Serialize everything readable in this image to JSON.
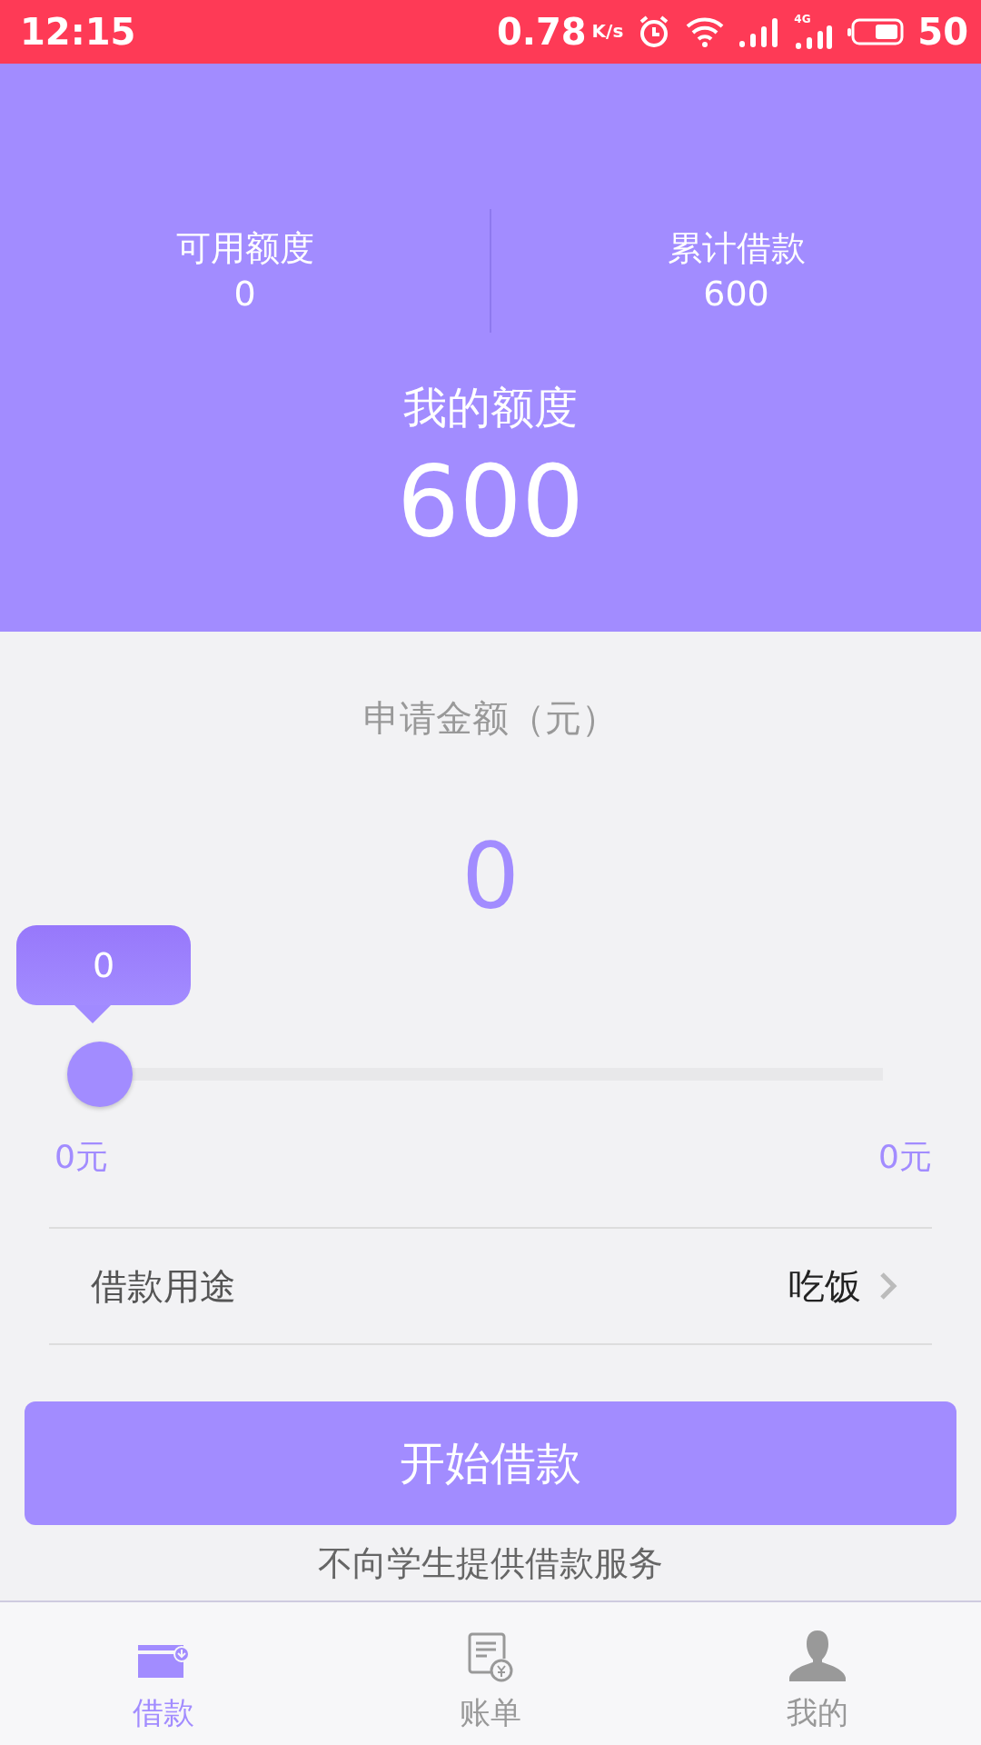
{
  "status_bar": {
    "time": "12:15",
    "speed": "0.78",
    "speed_unit": "K/s",
    "network": "4G",
    "battery": "50"
  },
  "summary": {
    "stats": [
      {
        "label": "可用额度",
        "value": "0"
      },
      {
        "label": "累计借款",
        "value": "600"
      }
    ],
    "quota_label": "我的额度",
    "quota_value": "600"
  },
  "amount": {
    "label": "申请金额（元）",
    "value": "0",
    "slider": {
      "bubble": "0",
      "level": 0,
      "min_label": "0元",
      "max_label": "0元"
    }
  },
  "purpose": {
    "label": "借款用途",
    "value": "吃饭"
  },
  "submit_button": "开始借款",
  "notice": "不向学生提供借款服务",
  "tabs": [
    {
      "label": "借款",
      "kind": "wallet",
      "selected": true
    },
    {
      "label": "账单",
      "kind": "bill",
      "selected": false
    },
    {
      "label": "我的",
      "kind": "person",
      "selected": false
    }
  ]
}
